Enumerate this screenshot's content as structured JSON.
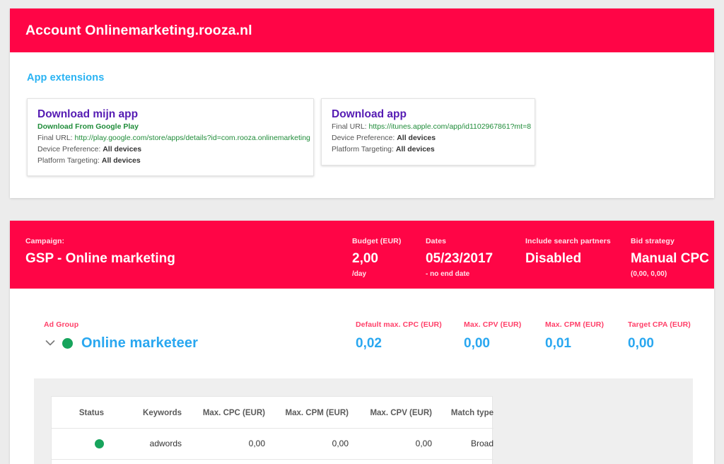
{
  "account": {
    "header_title": "Account Onlinemarketing.rooza.nl",
    "section_heading": "App extensions",
    "extensions": [
      {
        "title": "Download mijn app",
        "source": "Download From Google Play",
        "final_url_label": "Final URL:",
        "final_url": "http://play.google.com/store/apps/details?id=com.rooza.onlinemarketing",
        "device_pref_label": "Device Preference:",
        "device_pref_value": "All devices",
        "platform_label": "Platform Targeting:",
        "platform_value": "All devices"
      },
      {
        "title": "Download app",
        "source": "",
        "final_url_label": "Final URL:",
        "final_url": "https://itunes.apple.com/app/id1102967861?mt=8",
        "device_pref_label": "Device Preference:",
        "device_pref_value": "All devices",
        "platform_label": "Platform Targeting:",
        "platform_value": "All devices"
      }
    ]
  },
  "campaign": {
    "name_label": "Campaign:",
    "name_value": "GSP - Online marketing",
    "budget_label": "Budget (EUR)",
    "budget_value": "2,00",
    "budget_sub": "/day",
    "dates_label": "Dates",
    "dates_value": "05/23/2017",
    "dates_sub": "- no end date",
    "partners_label": "Include search partners",
    "partners_value": "Disabled",
    "bid_label": "Bid strategy",
    "bid_value": "Manual CPC",
    "bid_sub": "(0,00, 0,00)"
  },
  "adgroup": {
    "group_label": "Ad Group",
    "group_name": "Online marketeer",
    "metrics": [
      {
        "label": "Default max. CPC (EUR)",
        "value": "0,02"
      },
      {
        "label": "Max. CPV (EUR)",
        "value": "0,00"
      },
      {
        "label": "Max. CPM (EUR)",
        "value": "0,01"
      },
      {
        "label": "Target CPA (EUR)",
        "value": "0,00"
      }
    ]
  },
  "keywords_table": {
    "columns": [
      "Status",
      "Keywords",
      "Max. CPC (EUR)",
      "Max. CPM (EUR)",
      "Max. CPV (EUR)",
      "Match type"
    ],
    "rows": [
      {
        "status": "enabled",
        "keyword": "adwords",
        "max_cpc": "0,00",
        "max_cpm": "0,00",
        "max_cpv": "0,00",
        "match_type": "Broad"
      }
    ]
  },
  "colors": {
    "brand_red": "#ff0546",
    "link_blue": "#29a7f0",
    "heading_blue": "#29b3f3",
    "status_green": "#17a45c",
    "url_green": "#1f8c39",
    "title_purple": "#551bb3",
    "page_background": "#ececec"
  }
}
